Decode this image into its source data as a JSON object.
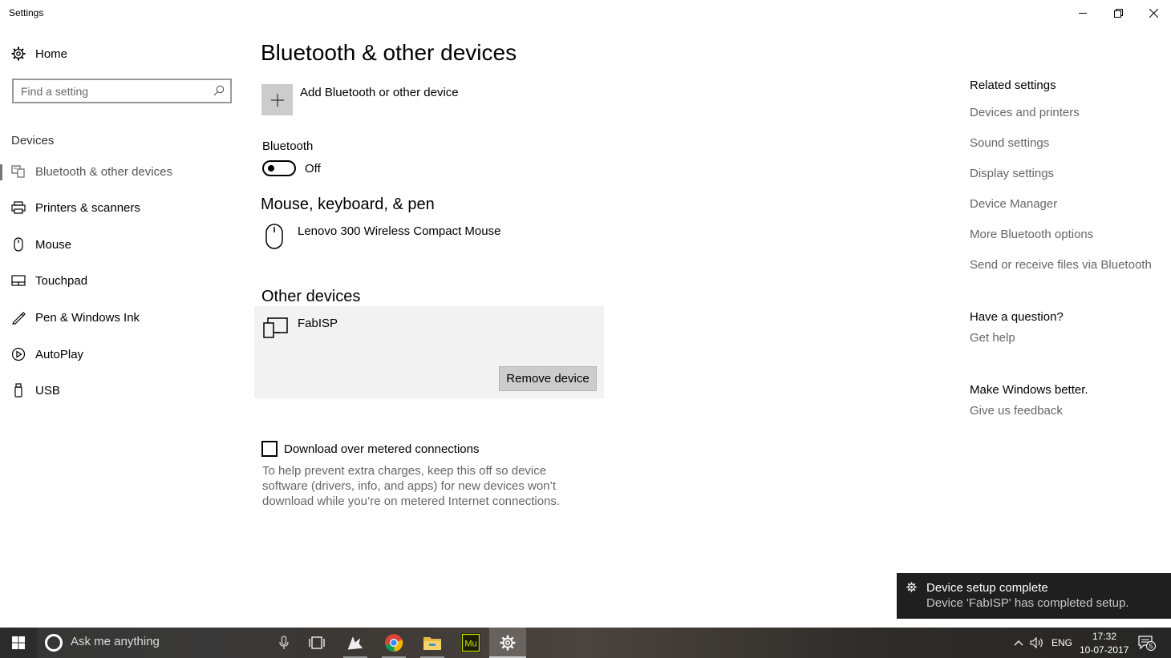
{
  "window": {
    "title": "Settings"
  },
  "sidebar": {
    "home_label": "Home",
    "search_placeholder": "Find a setting",
    "section_label": "Devices",
    "items": [
      {
        "label": "Bluetooth & other devices",
        "icon": "bluetooth-devices-icon",
        "active": true
      },
      {
        "label": "Printers & scanners",
        "icon": "printer-icon"
      },
      {
        "label": "Mouse",
        "icon": "mouse-icon"
      },
      {
        "label": "Touchpad",
        "icon": "touchpad-icon"
      },
      {
        "label": "Pen & Windows Ink",
        "icon": "pen-icon"
      },
      {
        "label": "AutoPlay",
        "icon": "autoplay-icon"
      },
      {
        "label": "USB",
        "icon": "usb-icon"
      }
    ]
  },
  "main": {
    "title": "Bluetooth & other devices",
    "add_device_label": "Add Bluetooth or other device",
    "bluetooth_label": "Bluetooth",
    "bluetooth_state": "Off",
    "mouse_section_title": "Mouse, keyboard, & pen",
    "mouse_device": "Lenovo 300 Wireless Compact Mouse",
    "other_section_title": "Other devices",
    "other_device": "FabISP",
    "remove_button": "Remove device",
    "metered_label": "Download over metered connections",
    "metered_checked": false,
    "metered_help": "To help prevent extra charges, keep this off so device software (drivers, info, and apps) for new devices won’t download while you’re on metered Internet connections."
  },
  "related": {
    "heading": "Related settings",
    "links": [
      "Devices and printers",
      "Sound settings",
      "Display settings",
      "Device Manager",
      "More Bluetooth options",
      "Send or receive files via Bluetooth"
    ],
    "question_heading": "Have a question?",
    "question_link": "Get help",
    "feedback_heading": "Make Windows better.",
    "feedback_link": "Give us feedback"
  },
  "toast": {
    "title": "Device setup complete",
    "body": "Device 'FabISP' has completed setup."
  },
  "taskbar": {
    "search_placeholder": "Ask me anything",
    "language": "ENG",
    "time": "17:32",
    "date": "10-07-2017",
    "notification_count": "5",
    "muse_label": "Mu"
  }
}
